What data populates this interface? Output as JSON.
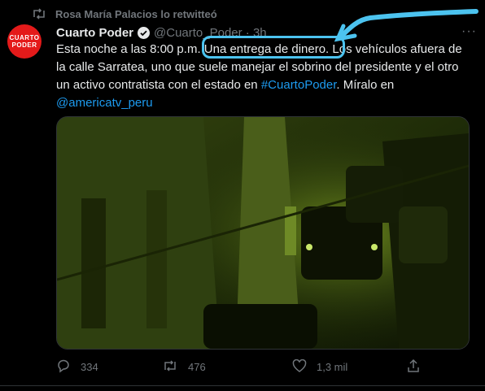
{
  "retweet_banner": {
    "text": "Rosa María Palacios lo retwitteó",
    "icon": "retweet-icon"
  },
  "author": {
    "avatar_line1": "CUARTO",
    "avatar_line2": "PODER",
    "name": "Cuarto Poder",
    "handle": "@Cuarto_Poder · 3h",
    "verified_icon": "verified-badge-icon"
  },
  "more_label": "···",
  "tweet": {
    "text_before": "Esta noche a las 8:00 p.m. Una entrega de dinero. Los vehículos afuera de la calle Sarratea, uno que suele manejar el sobrino del presidente y el otro un activo contratista con el estado en ",
    "hashtag": "#CuartoPoder",
    "text_middle": ". Míralo en ",
    "mention": "@americatv_peru"
  },
  "actions": {
    "reply_count": "334",
    "retweet_count": "476",
    "like_count": "1,3 mil"
  },
  "colors": {
    "accent": "#1d9bf0",
    "annotation": "#4cc3ef",
    "brand": "#e41a1a"
  }
}
